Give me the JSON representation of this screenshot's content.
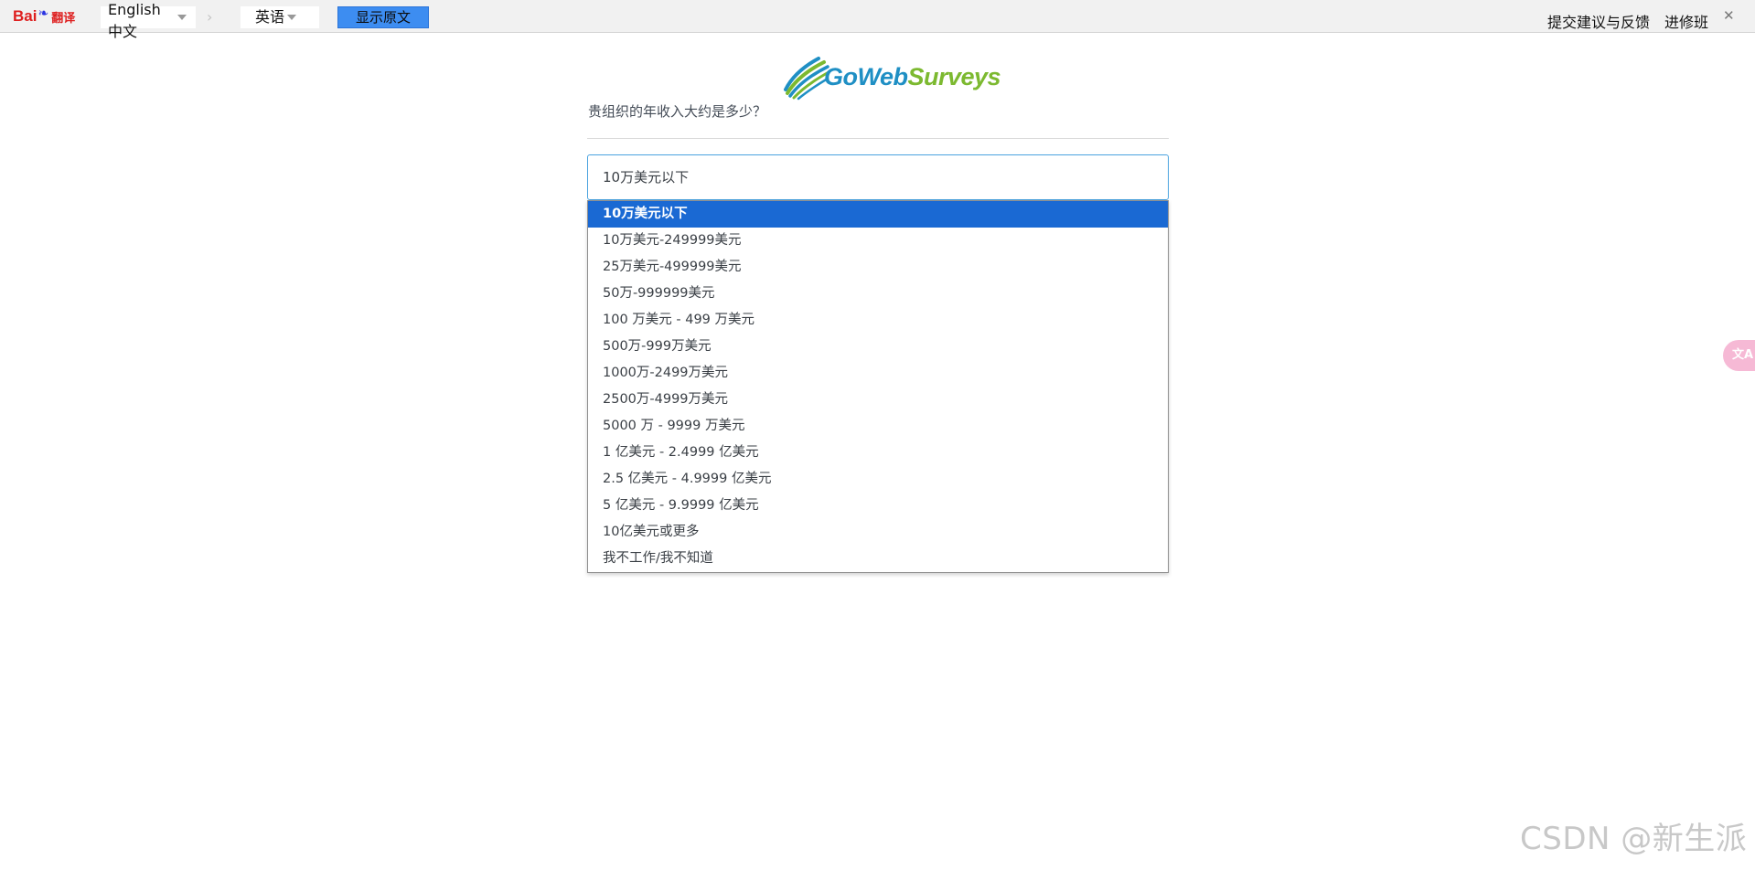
{
  "toolbar": {
    "logo_bai": "Bai",
    "logo_paw": "du",
    "logo_fanyi": "翻译",
    "source_lang": "English 中文",
    "target_lang": "英语",
    "show_original_label": "显示原文",
    "feedback_label": "提交建议与反馈",
    "advanced_label": "进修班",
    "close_glyph": "✕"
  },
  "survey": {
    "logo_part1": "GoWeb",
    "logo_part2": "Surveys",
    "question": "贵组织的年收入大约是多少？",
    "selected_value": "10万美元以下",
    "options": [
      "10万美元以下",
      "10万美元-249999美元",
      "25万美元-499999美元",
      "50万-999999美元",
      "100 万美元 - 499 万美元",
      "500万-999万美元",
      "1000万-2499万美元",
      "2500万-4999万美元",
      "5000 万 - 9999 万美元",
      "1 亿美元 - 2.4999 亿美元",
      "2.5 亿美元 - 4.9999 亿美元",
      "5 亿美元 - 9.9999 亿美元",
      "10亿美元或更多",
      "我不工作/我不知道"
    ],
    "selected_index": 0
  },
  "floating_tab": {
    "icon": "translate-icon",
    "glyph": "文A"
  },
  "watermark": "CSDN @新生派",
  "colors": {
    "toolbar_bg": "#f1f1f1",
    "button_blue": "#3d8df1",
    "selected_option": "#1a69d3",
    "select_border": "#4aa3df",
    "logo_blue": "#1f8fc4",
    "logo_green": "#7cb930",
    "float_tab_pink": "#f6b9d5"
  }
}
